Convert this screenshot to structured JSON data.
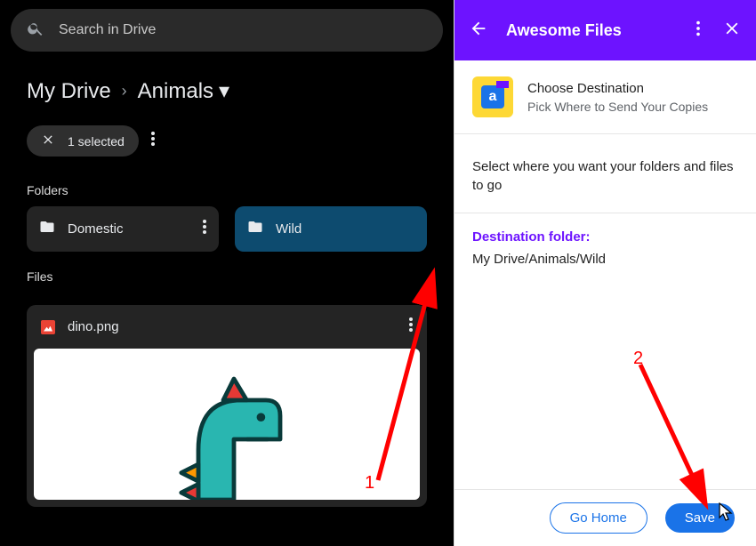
{
  "search": {
    "placeholder": "Search in Drive"
  },
  "breadcrumb": {
    "root": "My Drive",
    "current": "Animals"
  },
  "selection": {
    "text": "1 selected"
  },
  "sections": {
    "folders": "Folders",
    "files": "Files"
  },
  "folders": [
    {
      "name": "Domestic"
    },
    {
      "name": "Wild"
    }
  ],
  "files": [
    {
      "name": "dino.png"
    }
  ],
  "panel": {
    "title": "Awesome Files",
    "dest_title": "Choose Destination",
    "dest_sub": "Pick Where to Send Your Copies",
    "desc": "Select where you want your folders and files to go",
    "dest_label": "Destination folder:",
    "dest_path": "My Drive/Animals/Wild",
    "go_home": "Go Home",
    "save": "Save",
    "logo_letter": "a"
  },
  "annotations": {
    "one": "1",
    "two": "2"
  }
}
